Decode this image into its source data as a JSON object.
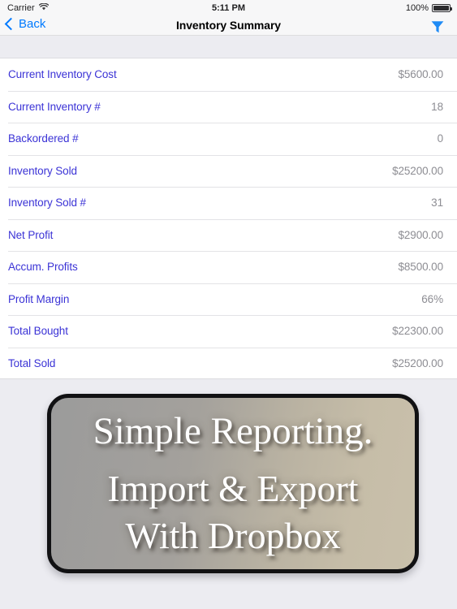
{
  "status_bar": {
    "carrier": "Carrier",
    "wifi_icon": "wifi-icon",
    "time": "5:11 PM",
    "battery_percent": "100%",
    "battery_icon": "battery-full-icon"
  },
  "nav_bar": {
    "back_label": "Back",
    "back_icon": "chevron-left-icon",
    "title": "Inventory Summary",
    "filter_icon": "funnel-filter-icon"
  },
  "table": {
    "rows": [
      {
        "label": "Current Inventory Cost",
        "value": "$5600.00"
      },
      {
        "label": "Current Inventory #",
        "value": "18"
      },
      {
        "label": "Backordered #",
        "value": "0"
      },
      {
        "label": "Inventory Sold",
        "value": "$25200.00"
      },
      {
        "label": "Inventory Sold #",
        "value": "31"
      },
      {
        "label": "Net Profit",
        "value": "$2900.00"
      },
      {
        "label": "Accum. Profits",
        "value": "$8500.00"
      },
      {
        "label": "Profit Margin",
        "value": "66%"
      },
      {
        "label": "Total Bought",
        "value": "$22300.00"
      },
      {
        "label": "Total Sold",
        "value": "$25200.00"
      }
    ]
  },
  "promo_banner": {
    "line_1": "Simple Reporting.",
    "line_2": "Import & Export",
    "line_3": "With Dropbox"
  },
  "colors": {
    "accent_blue": "#007aff",
    "label_blue": "#3b33d6",
    "value_gray": "#8d8d93",
    "page_background": "#ececf1",
    "bar_background": "#f7f7f8"
  }
}
